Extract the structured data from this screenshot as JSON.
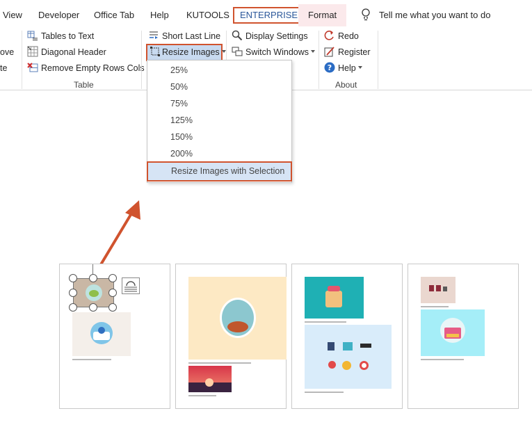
{
  "tabs": {
    "view": "View",
    "developer": "Developer",
    "office_tab": "Office Tab",
    "help": "Help",
    "kutools": "KUTOOLS",
    "enterprise": "ENTERPRISE",
    "format": "Format",
    "tell_me": "Tell me what you want to do"
  },
  "ribbon": {
    "partial_items": [
      "ove",
      "te"
    ],
    "table_group": {
      "label": "Table",
      "tables_to_text": "Tables to Text",
      "diagonal_header": "Diagonal Header",
      "remove_empty_rows_cols": "Remove Empty Rows Cols"
    },
    "middle_group": {
      "short_last_line": "Short Last Line",
      "resize_images": "Resize Images"
    },
    "view_group": {
      "display_settings": "Display Settings",
      "switch_windows": "Switch Windows"
    },
    "about_group": {
      "label": "About",
      "redo": "Redo",
      "register": "Register",
      "help": "Help"
    }
  },
  "resize_menu": {
    "options": [
      "25%",
      "50%",
      "75%",
      "125%",
      "150%",
      "200%"
    ],
    "with_selection": "Resize Images with Selection"
  },
  "colors": {
    "accent_outline": "#d0532e",
    "highlight": "#c8daf0",
    "format_tab_bg": "#fbe9eb",
    "enterprise_text": "#2b579a"
  }
}
